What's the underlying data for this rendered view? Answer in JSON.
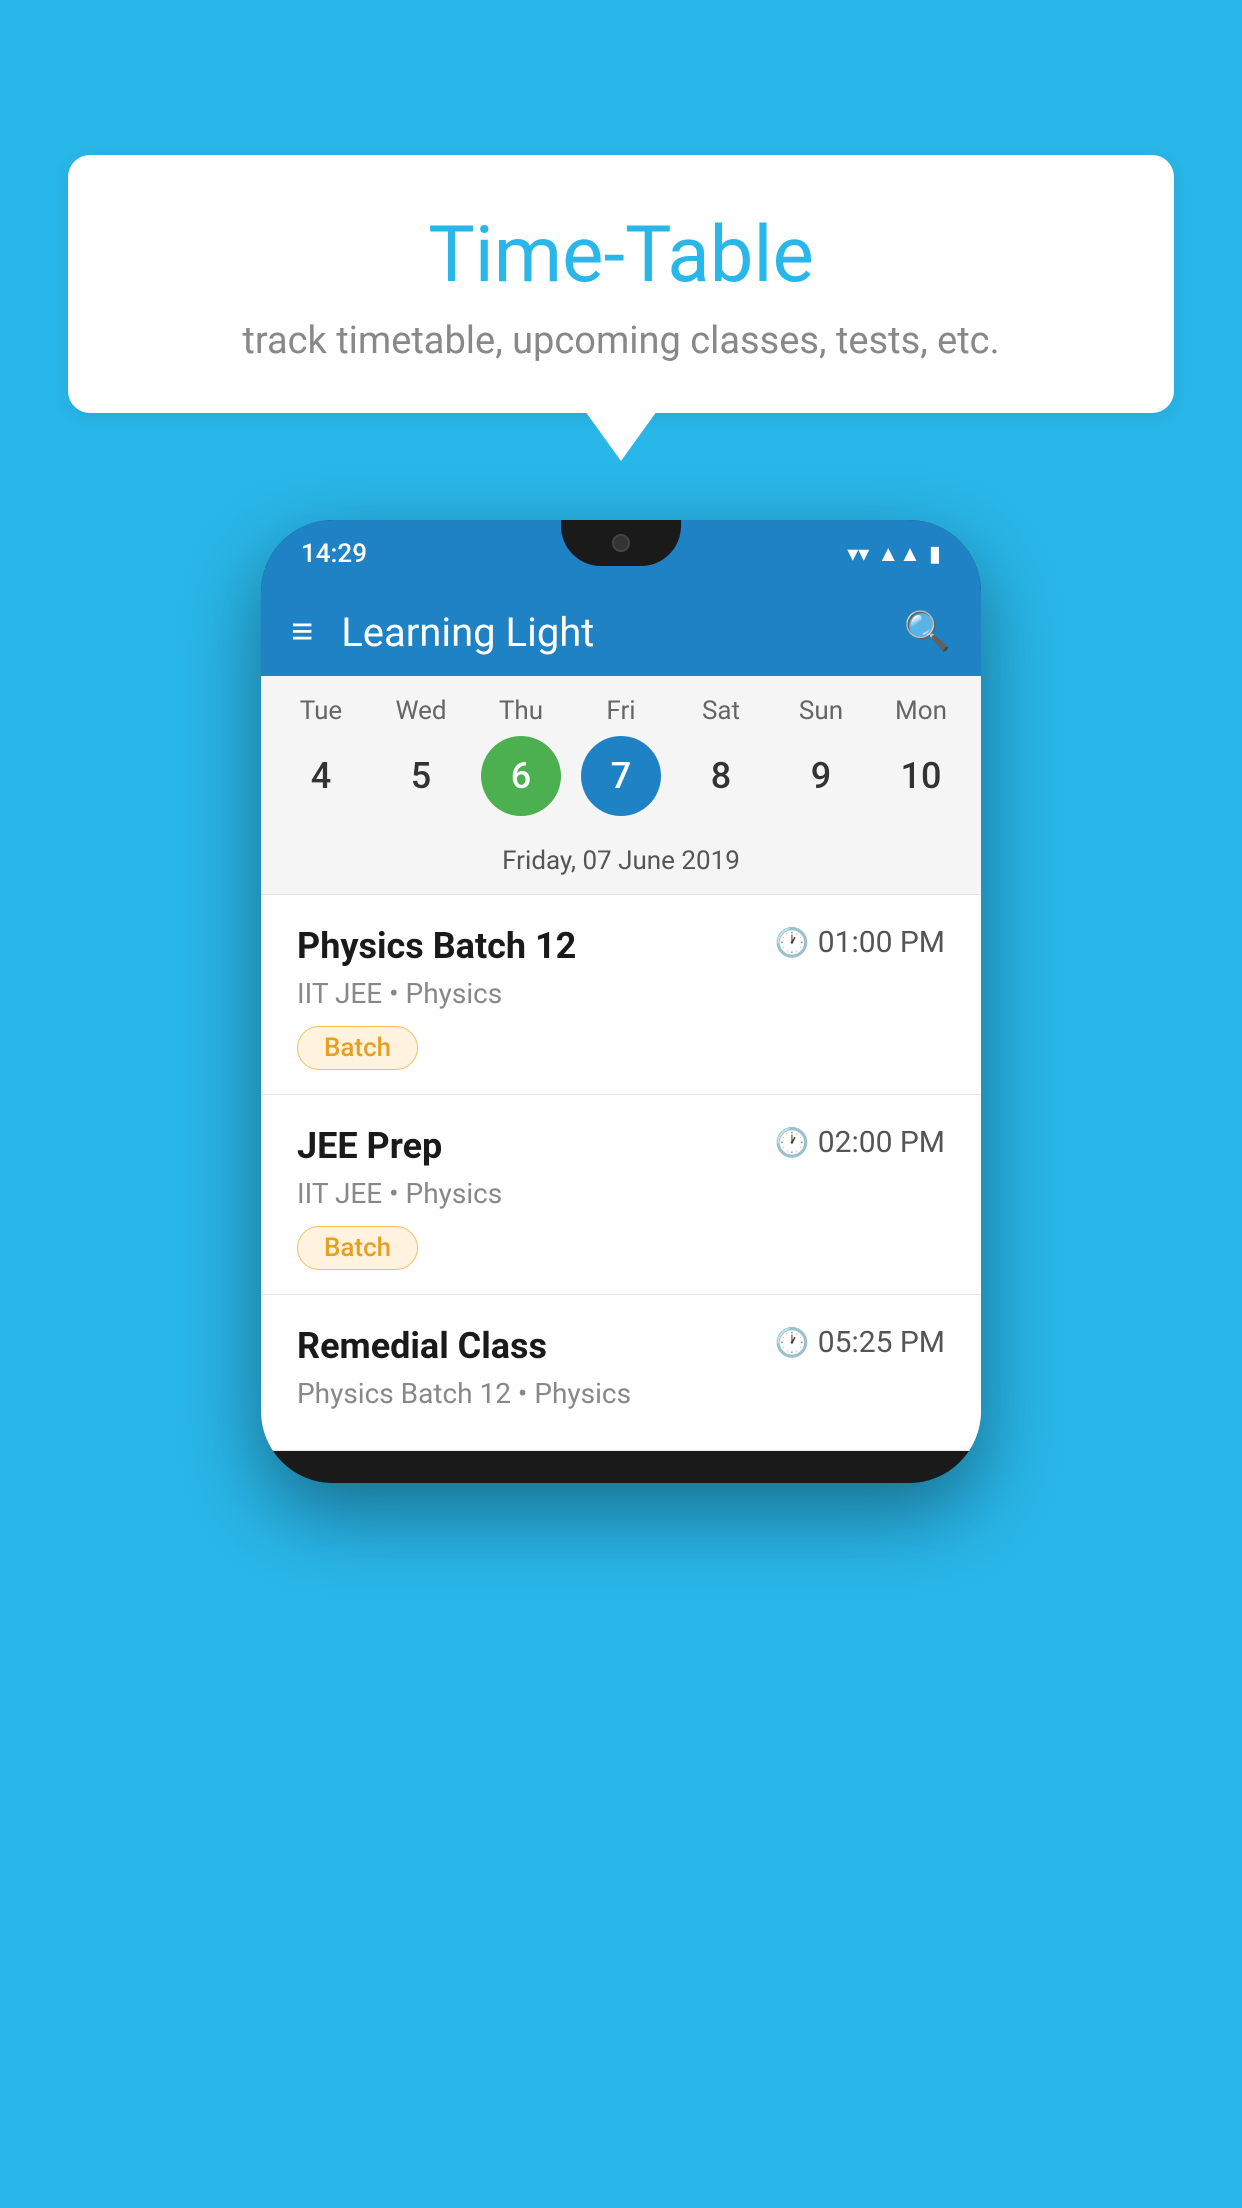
{
  "background_color": "#29b6e8",
  "bubble": {
    "title": "Time-Table",
    "subtitle": "track timetable, upcoming classes, tests, etc."
  },
  "phone": {
    "status_bar": {
      "time": "14:29"
    },
    "app_bar": {
      "title": "Learning Light"
    },
    "calendar": {
      "days": [
        {
          "name": "Tue",
          "number": "4",
          "state": "normal"
        },
        {
          "name": "Wed",
          "number": "5",
          "state": "normal"
        },
        {
          "name": "Thu",
          "number": "6",
          "state": "today"
        },
        {
          "name": "Fri",
          "number": "7",
          "state": "selected"
        },
        {
          "name": "Sat",
          "number": "8",
          "state": "normal"
        },
        {
          "name": "Sun",
          "number": "9",
          "state": "normal"
        },
        {
          "name": "Mon",
          "number": "10",
          "state": "normal"
        }
      ],
      "selected_date_label": "Friday, 07 June 2019"
    },
    "classes": [
      {
        "name": "Physics Batch 12",
        "time": "01:00 PM",
        "detail": "IIT JEE • Physics",
        "badge": "Batch"
      },
      {
        "name": "JEE Prep",
        "time": "02:00 PM",
        "detail": "IIT JEE • Physics",
        "badge": "Batch"
      },
      {
        "name": "Remedial Class",
        "time": "05:25 PM",
        "detail": "Physics Batch 12 • Physics",
        "badge": null
      }
    ]
  }
}
